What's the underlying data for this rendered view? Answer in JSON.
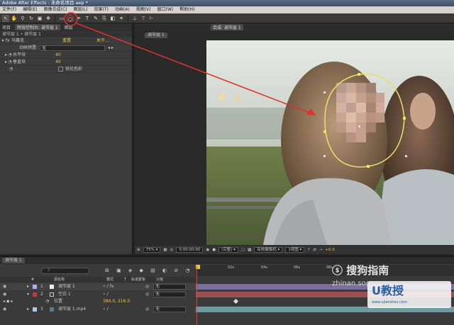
{
  "app": {
    "title": "Adobe After Effects - 未命名项目.aep *",
    "menu": [
      "文件(F)",
      "编辑(E)",
      "图像合成(C)",
      "图层(L)",
      "效果(T)",
      "动画(A)",
      "视图(V)",
      "窗口(W)",
      "帮助(H)"
    ]
  },
  "effects_panel": {
    "tabs": [
      "项目",
      "特效控制台: 调节层 1"
    ],
    "layer_label": "图层",
    "subtitle": "调节层 1 • 调节层 1",
    "effect_name": "马赛克",
    "reset_label": "重置",
    "about_label": "关于...",
    "preset_label": "动画预置:",
    "preset_value": "无",
    "h_blocks_label": "水平块",
    "h_blocks_value": "40",
    "v_blocks_label": "垂直块",
    "v_blocks_value": "40",
    "sharpen_label": "锐化色彩"
  },
  "comp_panel": {
    "tab": "合成: 调节层 1",
    "breadcrumb": "调节层 1",
    "zoom": "75%",
    "timecode": "0:00:00:00",
    "resolution": "(完整)",
    "camera": "有效摄像机",
    "views": "1视图",
    "exposure": "+0.0"
  },
  "timeline": {
    "tab": "调节层 1",
    "search_placeholder": "",
    "columns": [
      "#",
      "源名称",
      "模式",
      "T",
      "轨道蒙板",
      "父级"
    ],
    "layers": [
      {
        "num": "1",
        "name": "调节层 1",
        "parent": "无",
        "color": "#b7a8ff",
        "bar": "#7a6e9a"
      },
      {
        "num": "2",
        "name": "空白 1",
        "parent": "无",
        "color": "#c23a3a",
        "bar": "#9a5050"
      },
      {
        "num": "3",
        "name": "调节层 1.mp4",
        "parent": "无",
        "color": "#a7d1e0",
        "bar": "#6e9aa0"
      }
    ],
    "position_label": "位置",
    "position_value": "384.0, 216.0",
    "ruler_marks": [
      "02s",
      "04s",
      "06s",
      "08s"
    ]
  },
  "colors": {
    "accent": "#e8c84a",
    "annotation": "#e0332d"
  },
  "watermarks": [
    "搜狗指南",
    "zhinan.sogou.com",
    "U教授",
    "www.ujiaoshou.com"
  ]
}
